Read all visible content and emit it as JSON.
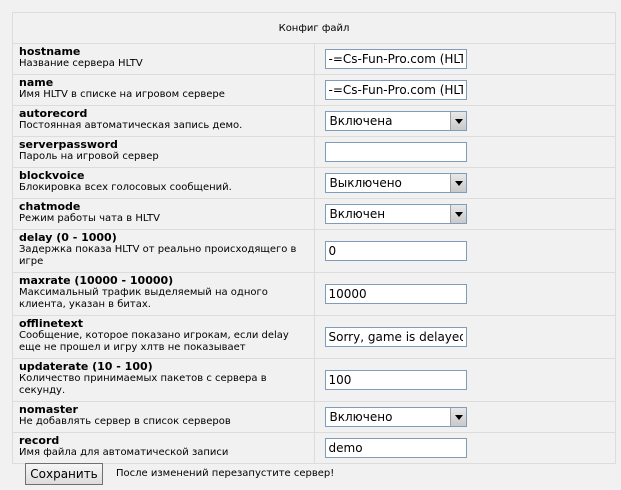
{
  "header": {
    "title": "Конфиг файл"
  },
  "options": [
    {
      "name": "hostname",
      "desc": "Название сервера HLTV",
      "type": "text",
      "value": "-=Cs-Fun-Pro.com (HLTV)"
    },
    {
      "name": "name",
      "desc": "Имя HLTV в списке на игровом сервере",
      "type": "text",
      "value": "-=Cs-Fun-Pro.com (HLTV)"
    },
    {
      "name": "autorecord",
      "desc": "Постоянная автоматическая запись демо.",
      "type": "select",
      "value": "Включена"
    },
    {
      "name": "serverpassword",
      "desc": "Пароль на игровой сервер",
      "type": "text",
      "value": ""
    },
    {
      "name": "blockvoice",
      "desc": "Блокировка всех голосовых сообщений.",
      "type": "select",
      "value": "Выключено"
    },
    {
      "name": "chatmode",
      "desc": "Режим работы чата в HLTV",
      "type": "select",
      "value": "Включен"
    },
    {
      "name": "delay (0 - 1000)",
      "desc": "Задержка показа HLTV от реально происходящего в игре",
      "type": "text",
      "value": "0"
    },
    {
      "name": "maxrate (10000 - 10000)",
      "desc": "Максимальный трафик выделяемый на одного клиента, указан в битах.",
      "type": "text",
      "value": "10000"
    },
    {
      "name": "offlinetext",
      "desc": "Сообщение, которое показано игрокам, если delay еще не прошел и игру хлтв не показывает",
      "type": "text",
      "value": "Sorry, game is delayed"
    },
    {
      "name": "updaterate (10 - 100)",
      "desc": "Количество принимаемых пакетов с сервера в секунду.",
      "type": "text",
      "value": "100"
    },
    {
      "name": "nomaster",
      "desc": "Не добавлять сервер в список серверов",
      "type": "select",
      "value": "Включено"
    },
    {
      "name": "record",
      "desc": "Имя файла для автоматической записи",
      "type": "text",
      "value": "demo"
    }
  ],
  "footer": {
    "save_label": "Сохранить",
    "note": "После изменений перезапустите сервер!"
  }
}
